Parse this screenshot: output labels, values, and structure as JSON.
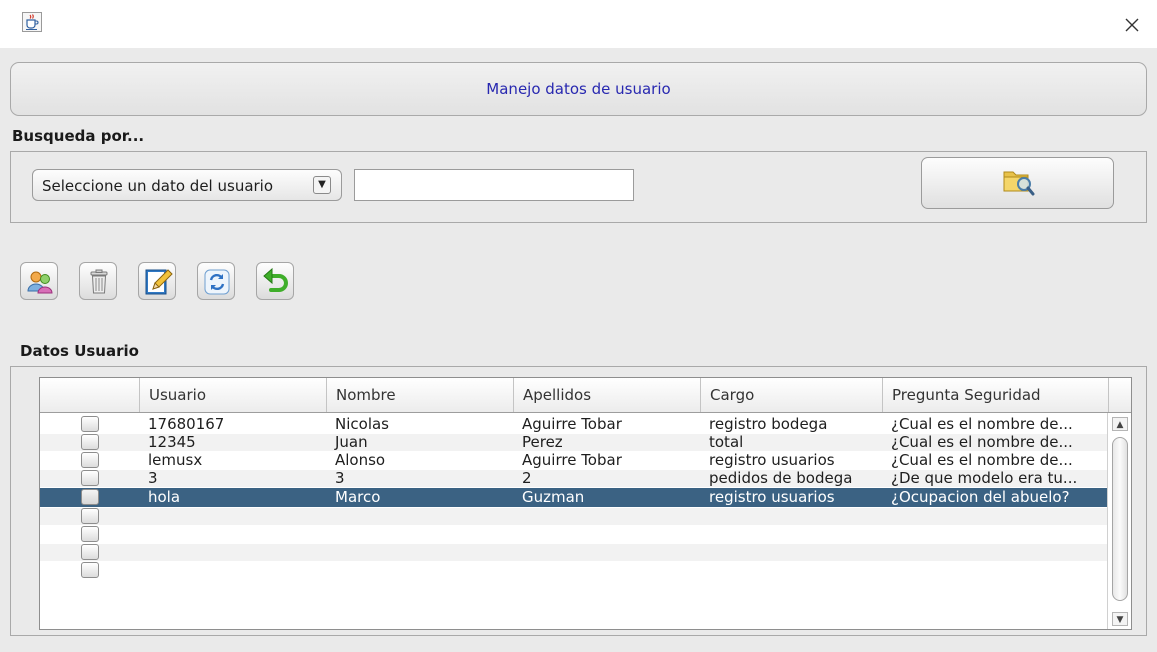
{
  "window": {
    "app_icon": "java-cup-icon",
    "close_icon": "close-icon"
  },
  "header": {
    "title": "Manejo datos de usuario"
  },
  "search": {
    "section_label": "Busqueda por...",
    "field_select": "Seleccione un dato del usuario",
    "input_value": "",
    "search_button_icon": "folder-search-icon"
  },
  "toolbar": {
    "buttons": [
      {
        "name": "add-users",
        "icon": "users-icon"
      },
      {
        "name": "delete",
        "icon": "trash-icon"
      },
      {
        "name": "edit",
        "icon": "edit-pencil-icon"
      },
      {
        "name": "refresh",
        "icon": "refresh-icon"
      },
      {
        "name": "undo",
        "icon": "undo-arrow-icon"
      }
    ]
  },
  "table": {
    "section_label": "Datos Usuario",
    "columns": [
      "",
      "Usuario",
      "Nombre",
      "Apellidos",
      "Cargo",
      "Pregunta Seguridad"
    ],
    "rows": [
      {
        "checked": false,
        "usuario": "17680167",
        "nombre": "Nicolas",
        "apellidos": "Aguirre Tobar",
        "cargo": "registro bodega",
        "pregunta": "¿Cual es el nombre de..."
      },
      {
        "checked": false,
        "usuario": "12345",
        "nombre": "Juan",
        "apellidos": "Perez",
        "cargo": "total",
        "pregunta": "¿Cual es el nombre de..."
      },
      {
        "checked": false,
        "usuario": "lemusx",
        "nombre": "Alonso",
        "apellidos": "Aguirre Tobar",
        "cargo": "registro usuarios",
        "pregunta": "¿Cual es el nombre de..."
      },
      {
        "checked": false,
        "usuario": "3",
        "nombre": "3",
        "apellidos": "2",
        "cargo": "pedidos de bodega",
        "pregunta": "¿De que modelo era tu..."
      },
      {
        "checked": false,
        "usuario": "hola",
        "nombre": "Marco",
        "apellidos": "Guzman",
        "cargo": "registro usuarios",
        "pregunta": "¿Ocupacion del abuelo?",
        "selected": true
      },
      {
        "checked": false,
        "usuario": "",
        "nombre": "",
        "apellidos": "",
        "cargo": "",
        "pregunta": ""
      },
      {
        "checked": false,
        "usuario": "",
        "nombre": "",
        "apellidos": "",
        "cargo": "",
        "pregunta": ""
      },
      {
        "checked": false,
        "usuario": "",
        "nombre": "",
        "apellidos": "",
        "cargo": "",
        "pregunta": ""
      },
      {
        "checked": false,
        "usuario": "",
        "nombre": "",
        "apellidos": "",
        "cargo": "",
        "pregunta": ""
      }
    ],
    "selection_color": "#3b6283"
  }
}
